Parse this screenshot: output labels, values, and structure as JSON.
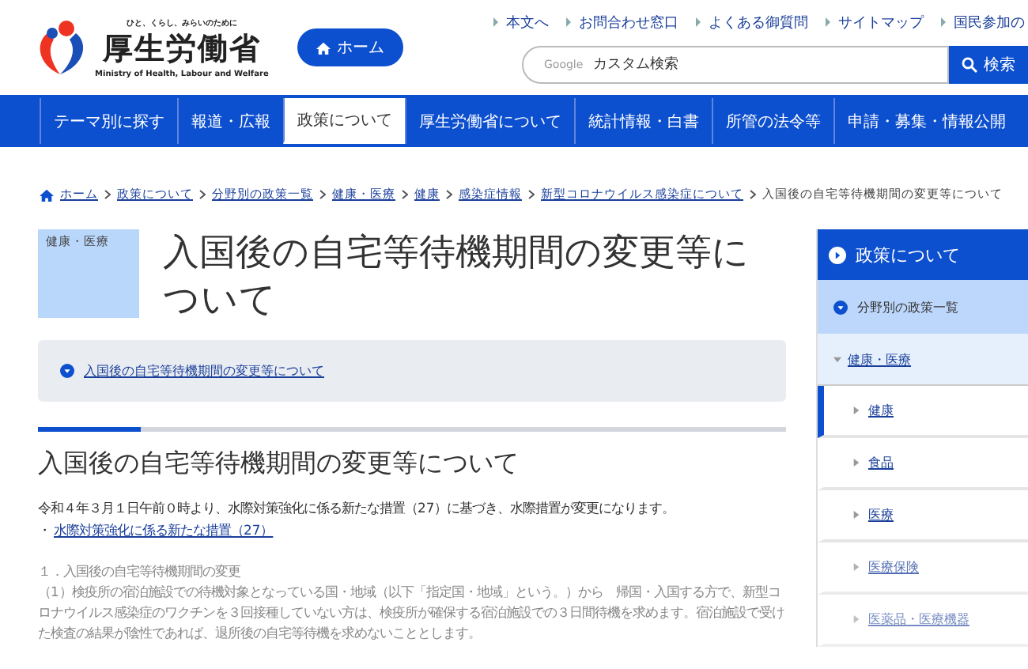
{
  "logo": {
    "tagline": "ひと、くらし、みらいのために",
    "name": "厚生労働省",
    "english": "Ministry of Health, Labour and Welfare"
  },
  "home_button": "ホーム",
  "utility_links": [
    "本文へ",
    "お問合わせ窓口",
    "よくある御質問",
    "サイトマップ",
    "国民参加の"
  ],
  "search": {
    "brand": "Google",
    "placeholder": "カスタム検索",
    "button": "検索"
  },
  "nav": [
    {
      "label": "テーマ別に探す",
      "selected": false
    },
    {
      "label": "報道・広報",
      "selected": false
    },
    {
      "label": "政策について",
      "selected": true
    },
    {
      "label": "厚生労働省について",
      "selected": false
    },
    {
      "label": "統計情報・白書",
      "selected": false
    },
    {
      "label": "所管の法令等",
      "selected": false
    },
    {
      "label": "申請・募集・情報公開",
      "selected": false
    }
  ],
  "breadcrumb": [
    "ホーム",
    "政策について",
    "分野別の政策一覧",
    "健康・医療",
    "健康",
    "感染症情報",
    "新型コロナウイルス感染症について",
    "入国後の自宅等待機期間の変更等について"
  ],
  "category_tag": "健康・医療",
  "page_title": "入国後の自宅等待機期間の変更等について",
  "toc": [
    "入国後の自宅等待機期間の変更等について"
  ],
  "section_heading": "入国後の自宅等待機期間の変更等について",
  "intro": "令和４年３月１日午前０時より、水際対策強化に係る新たな措置（27）に基づき、水際措置が変更になります。",
  "intro_bullet": "・",
  "intro_link": "水際対策強化に係る新たな措置（27）",
  "faded_heading": "１．入国後の自宅等待機期間の変更",
  "faded_paragraph": "（1）検疫所の宿泊施設での待機対象となっている国・地域（以下「指定国・地域」という。）から　帰国・入国する方で、新型コロナウイルス感染症のワクチンを３回接種していない方は、検疫所が確保する宿泊施設での３日間待機を求めます。宿泊施設で受けた検査の結果が陰性であれば、退所後の自宅等待機を求めないこととします。",
  "sidebar": {
    "title": "政策について",
    "section": "分野別の政策一覧",
    "group": "健康・医療",
    "items": [
      {
        "label": "健康",
        "selected": true
      },
      {
        "label": "食品",
        "selected": false
      },
      {
        "label": "医療",
        "selected": false
      },
      {
        "label": "医療保険",
        "selected": false
      },
      {
        "label": "医薬品・医療機器",
        "selected": false
      }
    ]
  }
}
